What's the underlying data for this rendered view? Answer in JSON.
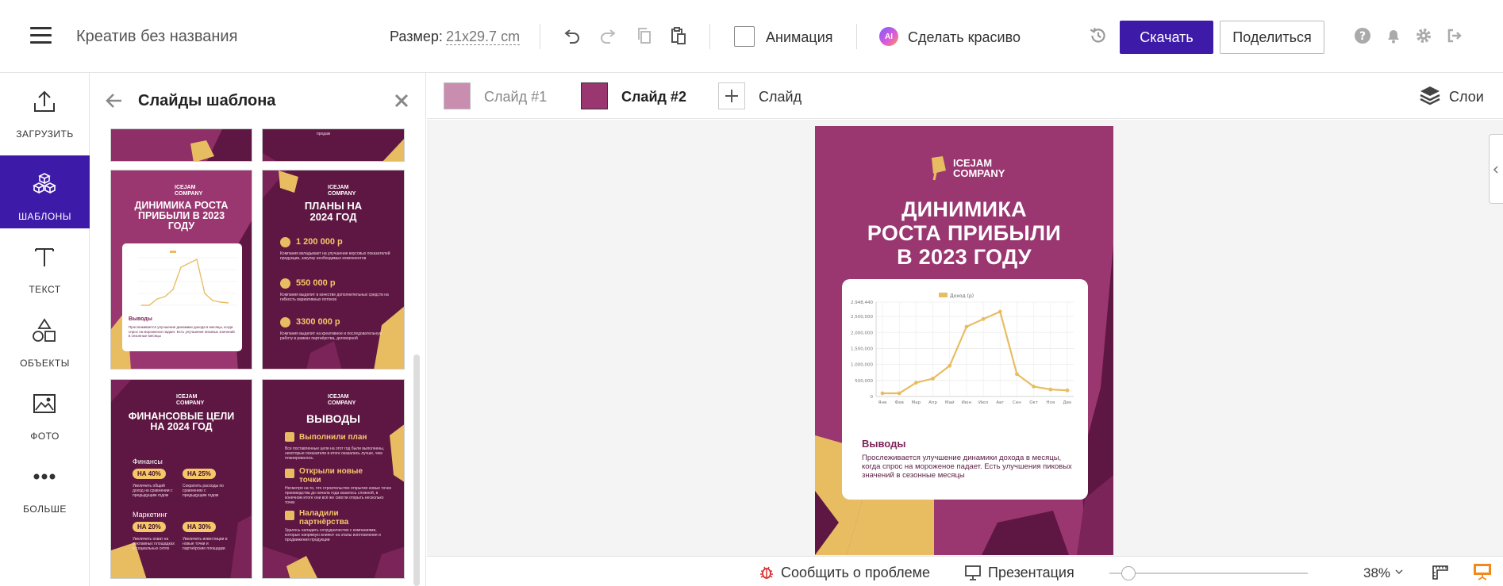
{
  "topbar": {
    "doc_title": "Креатив без названия",
    "size_label": "Размер:",
    "size_value": "21x29.7",
    "size_unit": "cm",
    "animation_label": "Анимация",
    "ai_badge": "AI",
    "beautify_label": "Сделать красиво",
    "download_label": "Скачать",
    "share_label": "Поделиться"
  },
  "leftnav": {
    "items": [
      {
        "label": "ЗАГРУЗИТЬ",
        "icon": "upload-icon"
      },
      {
        "label": "ШАБЛОНЫ",
        "icon": "templates-icon",
        "active": true
      },
      {
        "label": "ТЕКСТ",
        "icon": "text-icon"
      },
      {
        "label": "ОБЪЕКТЫ",
        "icon": "shapes-icon"
      },
      {
        "label": "ФОТО",
        "icon": "photo-icon"
      },
      {
        "label": "БОЛЬШЕ",
        "icon": "more-icon"
      }
    ]
  },
  "panel": {
    "title": "Слайды шаблона",
    "thumbs": {
      "t1": {
        "logo": "ICEJAM\nCOMPANY",
        "title": "ДИНИМИКА РОСТА ПРИБЫЛИ В 2023 ГОДУ",
        "legend": "Доход",
        "heading": "Выводы",
        "text": "Прослеживается улучшение динамики дохода в месяцы, когда спрос на мороженое падает. Есть улучшения пиковых значений в сезонные месяцы"
      },
      "t2": {
        "logo": "ICEJAM\nCOMPANY",
        "title": "ПЛАНЫ НА 2024 ГОД",
        "amounts": [
          "1 200 000 р",
          "550 000 р",
          "3300 000 р"
        ],
        "texts": [
          "Компания вкладывает на улучшение вкусовых показателей продукции, закупку необходимых компонентов",
          "Компания выделит в качестве дополнительных средств на гибкость вариативных потоков",
          "Компания выделит на креативное и последовательную работу в рамках партнёрства, договорной"
        ]
      },
      "t3": {
        "logo": "ICEJAM\nCOMPANY",
        "title": "ФИНАНСОВЫЕ ЦЕЛИ НА 2024 ГОД",
        "sections": [
          {
            "name": "Финансы",
            "pills": [
              "НА 40%",
              "НА 25%"
            ],
            "texts": [
              "Увеличить общий доход на сравнении с предыдущим годом",
              "Сократить расходы по сравнению с предыдущим годом"
            ]
          },
          {
            "name": "Маркетинг",
            "pills": [
              "НА 20%",
              "НА 30%"
            ],
            "texts": [
              "Увеличить охват на рекламных площадках и социальных сетях",
              "Увеличить инвестиции в новые точки и партнёрские площадки"
            ]
          }
        ]
      },
      "t4": {
        "logo": "ICEJAM\nCOMPANY",
        "title": "ВЫВОДЫ",
        "items": [
          {
            "title": "Выполнили план",
            "text": "Все поставленные цели на этот год были выполнены, некоторые показатели в итоге оказались лучше, чем планировалось"
          },
          {
            "title": "Открыли новые точки",
            "text": "Несмотря на то, что строительство открытия новых точек производства до начала года казалось сложной, в конечном итоге они всё же смогли открыть несколько точек"
          },
          {
            "title": "Наладили партнёрства",
            "text": "Удалось наладить сотрудничество с компаниями, которые напрямую влияют на этапы изготовления и продвижения продукции"
          }
        ]
      },
      "top_left_text": "",
      "top_right_text": "продаж"
    }
  },
  "slidetabs": {
    "tabs": [
      {
        "label": "Слайд #1",
        "color": "#c98db0"
      },
      {
        "label": "Слайд #2",
        "color": "#9a3670",
        "active": true
      }
    ],
    "add_label": "Слайд",
    "layers_label": "Слои"
  },
  "slide": {
    "logo_line1": "ICEJAM",
    "logo_line2": "COMPANY",
    "title_lines": [
      "ДИНИМИКА",
      "РОСТА ПРИБЫЛИ",
      "В 2023 ГОДУ"
    ],
    "card_heading": "Выводы",
    "card_text": "Прослеживается улучшение динамики дохода в месяцы, когда спрос на мороженое падает. Есть улучшения пиковых значений в сезонные месяцы",
    "colors": {
      "background": "#9a3670",
      "dark": "#5e1742",
      "accent": "#e8bd62"
    }
  },
  "chart_data": {
    "type": "line",
    "title": "",
    "xlabel": "",
    "ylabel": "",
    "legend": {
      "entries": [
        "Доход (р)"
      ],
      "placement": "top-center"
    },
    "categories": [
      "Янв",
      "Фев",
      "Мар",
      "Апр",
      "Май",
      "Июн",
      "Июл",
      "Авг",
      "Сен",
      "Окт",
      "Ноя",
      "Дек"
    ],
    "series": [
      {
        "name": "Доход (р)",
        "values": [
          100000,
          100000,
          430000,
          560000,
          960000,
          2180000,
          2420000,
          2650000,
          700000,
          310000,
          220000,
          190000
        ],
        "color": "#e8bd62"
      }
    ],
    "y_ticks": [
      "0",
      "500,000",
      "1,000,000",
      "1,500,000",
      "2,000,000",
      "2,500,000",
      "2,948,440"
    ],
    "ylim": [
      0,
      2948440
    ],
    "grid": true
  },
  "bottombar": {
    "report_label": "Сообщить о проблеме",
    "present_label": "Презентация",
    "zoom_value": "38%",
    "zoom_level": 0.38
  }
}
